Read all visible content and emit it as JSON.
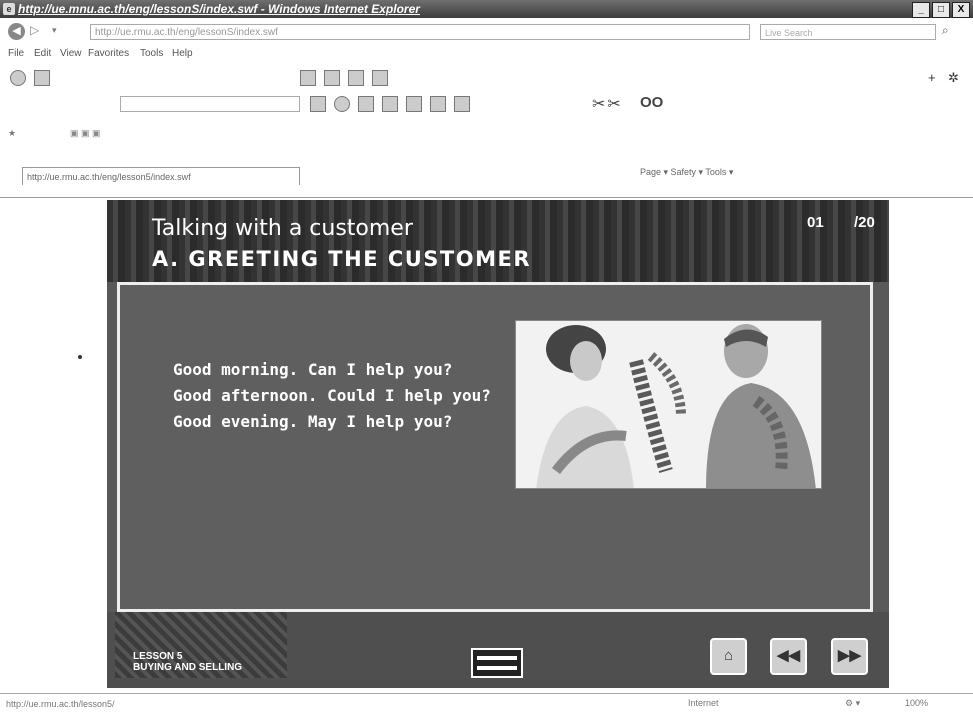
{
  "window": {
    "title": "http://ue.mnu.ac.th/eng/lessonS/index.swf - Windows Internet Explorer",
    "buttons": {
      "min": "_",
      "max": "□",
      "close": "X"
    }
  },
  "address_bar": {
    "url": "http://ue.rmu.ac.th/eng/lessonS/index.swf",
    "search_placeholder": "Live Search"
  },
  "menu": [
    "File",
    "Edit",
    "View",
    "Favorites",
    "Tools",
    "Help"
  ],
  "tabs": {
    "active_tab": "http://ue.rmu.ac.th/eng/lesson5/index.swf",
    "command_bar": "Page ▾ Safety ▾ Tools ▾"
  },
  "lesson": {
    "title": "Talking with a customer",
    "subtitle": "A. GREETING THE CUSTOMER",
    "page_current": "01",
    "page_total": "/20",
    "lines": [
      "Good morning. Can I help you?",
      "Good afternoon. Could I help you?",
      "Good evening. May I help you?"
    ],
    "lesson_label": "LESSON 5",
    "lesson_name": "BUYING AND SELLING",
    "nav": {
      "home": "⌂",
      "prev": "◀◀",
      "next": "▶▶"
    }
  },
  "status": {
    "url": "http://ue.rmu.ac.th/lesson5/",
    "zone": "Internet",
    "zoom": "100%"
  }
}
